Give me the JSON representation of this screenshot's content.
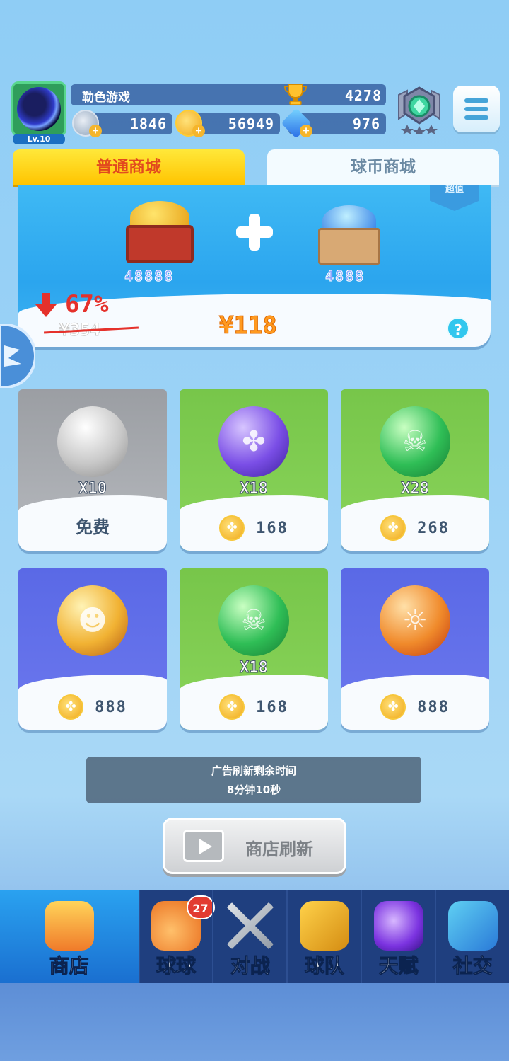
{
  "player": {
    "name": "勒色游戏",
    "level": "Lv.10",
    "trophies": "4278",
    "energy": "1846",
    "coins": "56949",
    "gems": "976"
  },
  "tabs": [
    {
      "label": "普通商城",
      "active": true
    },
    {
      "label": "球币商城",
      "active": false
    }
  ],
  "banner": {
    "tag": "超值",
    "coins_qty": "48888",
    "gems_qty": "4888",
    "discount": "67%",
    "old_price": "¥354",
    "new_price": "¥118",
    "help": "?"
  },
  "shop_items": [
    {
      "icon": "silver-ore-icon",
      "count": "X10",
      "price": "免费",
      "free": true,
      "theme": "grey"
    },
    {
      "icon": "purple-clover-orb-icon",
      "count": "X18",
      "price": "168",
      "free": false,
      "theme": "green"
    },
    {
      "icon": "green-skull-orb-icon",
      "count": "X28",
      "price": "268",
      "free": false,
      "theme": "green"
    },
    {
      "icon": "yellow-pumpkin-orb-icon",
      "count": "",
      "price": "888",
      "free": false,
      "theme": "purple"
    },
    {
      "icon": "green-skull-orb-icon",
      "count": "X18",
      "price": "168",
      "free": false,
      "theme": "green"
    },
    {
      "icon": "orange-sun-orb-icon",
      "count": "",
      "price": "888",
      "free": false,
      "theme": "purple"
    }
  ],
  "ad_refresh": {
    "line1": "广告刷新剩余时间",
    "line2": "8分钟10秒"
  },
  "refresh_button": "商店刷新",
  "nav": [
    {
      "label": "商店",
      "icon": "shop-icon",
      "active": true,
      "badge": ""
    },
    {
      "label": "球球",
      "icon": "ball-icon",
      "active": false,
      "badge": "27"
    },
    {
      "label": "对战",
      "icon": "crossed-swords-icon",
      "active": false,
      "badge": ""
    },
    {
      "label": "球队",
      "icon": "whistle-icon",
      "active": false,
      "badge": ""
    },
    {
      "label": "天赋",
      "icon": "planet-icon",
      "active": false,
      "badge": ""
    },
    {
      "label": "社交",
      "icon": "chat-heart-icon",
      "active": false,
      "badge": ""
    }
  ],
  "colors": {
    "tab_active": "#ffc400",
    "price_orange": "#ff9a1f",
    "discount_red": "#e5312b",
    "nav_bg": "#1f3f7f"
  }
}
